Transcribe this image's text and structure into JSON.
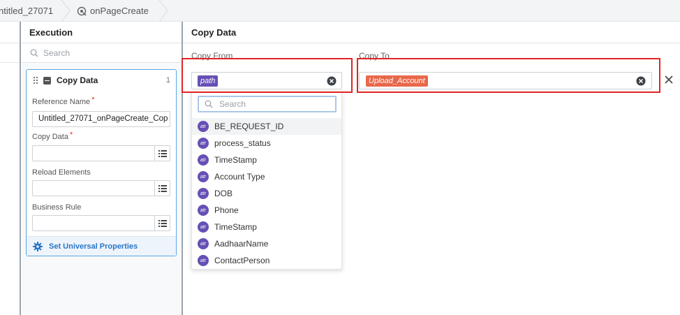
{
  "breadcrumb": {
    "items": [
      {
        "label": "ntitled_27071"
      },
      {
        "label": "onPageCreate"
      }
    ]
  },
  "execution_panel": {
    "title": "Execution",
    "search_placeholder": "Search",
    "card": {
      "title": "Copy Data",
      "index": "1",
      "reference_name_label": "Reference Name",
      "reference_name_value": "Untitled_27071_onPageCreate_Cop",
      "copy_data_label": "Copy Data",
      "reload_elements_label": "Reload Elements",
      "business_rule_label": "Business Rule",
      "universal_properties_label": "Set Universal Properties"
    }
  },
  "copy_panel": {
    "title": "Copy Data",
    "copy_from_label": "Copy From",
    "copy_to_label": "Copy To",
    "from_tag": "path",
    "to_tag": "Upload_Account",
    "dropdown": {
      "search_placeholder": "Search",
      "badge": "atr",
      "items": [
        {
          "label": "BE_REQUEST_ID"
        },
        {
          "label": "process_status"
        },
        {
          "label": "TimeStamp"
        },
        {
          "label": "Account Type"
        },
        {
          "label": "DOB"
        },
        {
          "label": "Phone"
        },
        {
          "label": "TimeStamp"
        },
        {
          "label": "AadhaarName"
        },
        {
          "label": "ContactPerson"
        }
      ]
    }
  },
  "colors": {
    "accent": "#2a76c7",
    "attribute_badge": "#6650b4",
    "target_tag": "#e8684a",
    "highlight_box": "#e02424",
    "card_border": "#5aa7e0"
  },
  "icons": {
    "designer": "activity-icon",
    "search": "search-icon",
    "drag": "drag-handle-icon",
    "collapse": "collapse-icon",
    "list": "list-icon",
    "settings": "gear-icon",
    "clear": "clear-circle-icon",
    "close": "close-icon"
  }
}
